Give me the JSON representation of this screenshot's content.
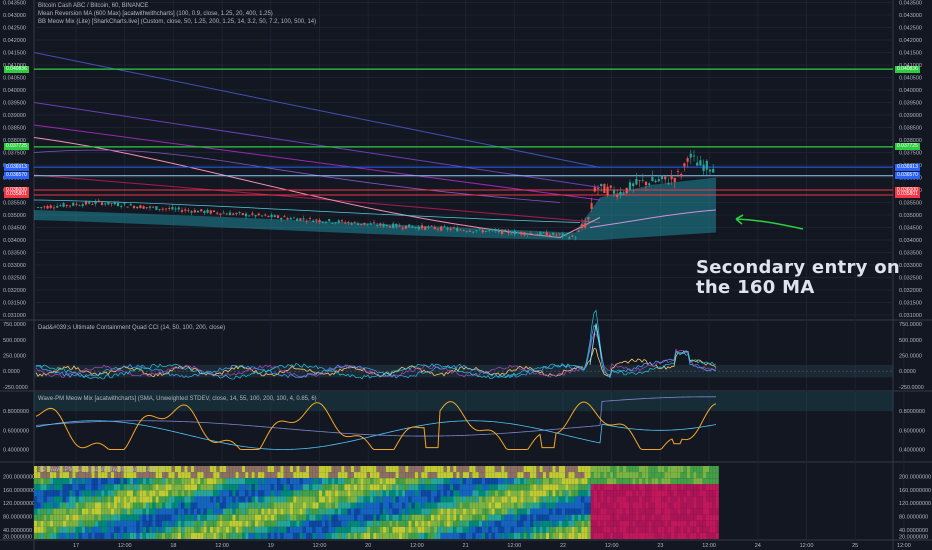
{
  "legend": {
    "symbol_line": "Bitcoin Cash ABC / Bitcoin, 60, BINANCE",
    "indicator_1": "Mean Reversion MA (600 Max) [acatwithwithcharts] (100, 0.9, close, 1.25, 20, 400, 1.25)",
    "indicator_2": "BB Meow Mix (Lite) [SharkCharts.live] (Custom, close, 50, 1.25, 200, 1.25, 14, 3.2, 50, 7.2, 100, 500, 14)"
  },
  "panes": {
    "cci_label": "Dad&#039;s Ultimate Containment Quad CCI (14, 50, 100, 200, close)",
    "wave_label": "Wave-PM Meow Mix [acatwithcharts] (SMA, Unweighted STDEV, close, 14, 55, 100, 200, 100, 4, 0.85, 6)",
    "heat_label": "3D Wave-PM (Lite) [acatwithwithcharts] (100, 4)"
  },
  "annotation": {
    "text": "Secondary entry on\nthe 160 MA",
    "color": "#e0e3eb",
    "arrow_color": "#2ecc40"
  },
  "price_axis": {
    "ticks": [
      "0.043500",
      "0.043000",
      "0.042500",
      "0.042000",
      "0.041500",
      "0.041000",
      "0.040500",
      "0.040000",
      "0.039500",
      "0.039000",
      "0.038500",
      "0.038000",
      "0.037500",
      "0.037000",
      "0.036500",
      "0.036000",
      "0.035500",
      "0.035000",
      "0.034500",
      "0.034000",
      "0.033500",
      "0.033000",
      "0.032500",
      "0.032000",
      "0.031500",
      "0.031000"
    ],
    "tags": [
      {
        "text": "0.040836",
        "color": "#2ecc40",
        "price": 0.040836
      },
      {
        "text": "0.037725",
        "color": "#2ecc40",
        "price": 0.037725
      },
      {
        "text": "0.036913",
        "color": "#2962ff",
        "price": 0.036913
      },
      {
        "text": "0.036570",
        "color": "#2962ff",
        "price": 0.03657
      },
      {
        "text": "0.036000",
        "color": "#f23645",
        "price": 0.036
      },
      {
        "text": "0.035801",
        "color": "#f23645",
        "price": 0.035801
      }
    ]
  },
  "cci_axis": {
    "ticks": [
      "750.0000",
      "500.0000",
      "250.0000",
      "0.0000",
      "-250.0000"
    ]
  },
  "wave_axis": {
    "ticks": [
      "0.8000000",
      "0.6000000",
      "0.4000000"
    ]
  },
  "heat_axis": {
    "ticks": [
      "200.0000000",
      "160.0000000",
      "120.0000000",
      "80.0000000",
      "40.0000000",
      "20.0000000"
    ]
  },
  "time_axis": {
    "ticks": [
      "17",
      "12:00",
      "18",
      "12:00",
      "19",
      "12:00",
      "20",
      "12:00",
      "21",
      "12:00",
      "22",
      "12:00",
      "23",
      "12:00",
      "24",
      "12:00",
      "25",
      "12:00"
    ]
  },
  "levels": {
    "green_upper": 0.040836,
    "green_lower": 0.037725,
    "blue_upper": 0.036913,
    "blue_lower": 0.03657,
    "red_upper": 0.036,
    "red_lower": 0.035801
  },
  "colors": {
    "background": "#131722",
    "bull": "#26a69a",
    "bear": "#ef5350",
    "green_line": "#2ecc40",
    "blue_line": "#2962ff",
    "red_line": "#f23645"
  }
}
